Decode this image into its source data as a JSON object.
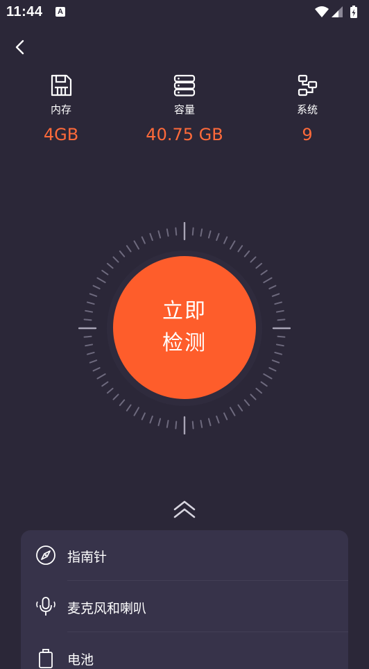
{
  "status_bar": {
    "time": "11:44",
    "notification_glyph": "A",
    "icons": [
      "wifi-icon",
      "signal-icon",
      "battery-charging-icon"
    ]
  },
  "nav": {
    "back_icon": "chevron-left-icon"
  },
  "stats": [
    {
      "icon": "save-icon",
      "label": "内存",
      "value": "4GB"
    },
    {
      "icon": "storage-icon",
      "label": "容量",
      "value": "40.75 GB"
    },
    {
      "icon": "network-icon",
      "label": "系统",
      "value": "9"
    }
  ],
  "detect_button": {
    "line1": "立即",
    "line2": "检测"
  },
  "expand_icon": "double-chevron-up-icon",
  "list": [
    {
      "icon": "compass-icon",
      "label": "指南针"
    },
    {
      "icon": "microphone-icon",
      "label": "麦克风和喇叭"
    },
    {
      "icon": "battery-icon",
      "label": "电池"
    }
  ],
  "colors": {
    "background": "#2b2738",
    "accent": "#fe5d2b",
    "value_text": "#ff6a3a",
    "panel": "#37334a"
  }
}
